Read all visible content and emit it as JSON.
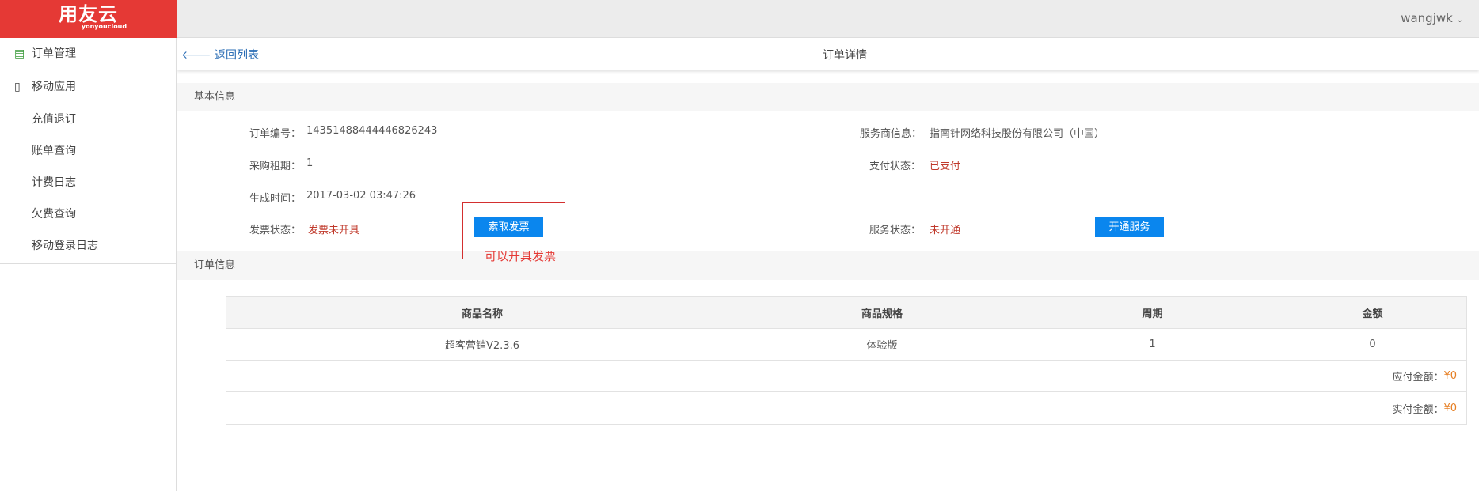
{
  "brand": {
    "name": "用友云",
    "sub": "yonyoucloud"
  },
  "header": {
    "user": "wangjwk"
  },
  "sidebar": {
    "items": [
      {
        "label": "订单管理",
        "icon": "order-list-icon"
      },
      {
        "label": "移动应用",
        "icon": "mobile-icon"
      },
      {
        "label": "充值退订"
      },
      {
        "label": "账单查询"
      },
      {
        "label": "计费日志"
      },
      {
        "label": "欠费查询"
      },
      {
        "label": "移动登录日志"
      }
    ]
  },
  "subbar": {
    "back": "返回列表",
    "title": "订单详情"
  },
  "basic": {
    "title": "基本信息",
    "order_no_label": "订单编号：",
    "order_no": "14351488444446826243",
    "period_label": "采购租期：",
    "period": "1",
    "created_label": "生成时间：",
    "created": "2017-03-02 03:47:26",
    "invoice_label": "发票状态：",
    "invoice": "发票未开具",
    "invoice_btn": "索取发票",
    "provider_label": "服务商信息：",
    "provider": "指南针网络科技股份有限公司（中国）",
    "pay_label": "支付状态：",
    "pay": "已支付",
    "service_label": "服务状态：",
    "service": "未开通",
    "service_btn": "开通服务",
    "annotation": "可以开具发票"
  },
  "order": {
    "title": "订单信息",
    "columns": [
      "商品名称",
      "商品规格",
      "周期",
      "金额"
    ],
    "rows": [
      [
        "超客营销V2.3.6",
        "体验版",
        "1",
        "0"
      ]
    ],
    "payable_label": "应付金额：",
    "payable": "¥0",
    "paid_label": "实付金额：",
    "paid": "¥0"
  },
  "colors": {
    "brand": "#e53935",
    "primary": "#0a86ee",
    "status": "#c0392b",
    "amount": "#e67e22"
  }
}
